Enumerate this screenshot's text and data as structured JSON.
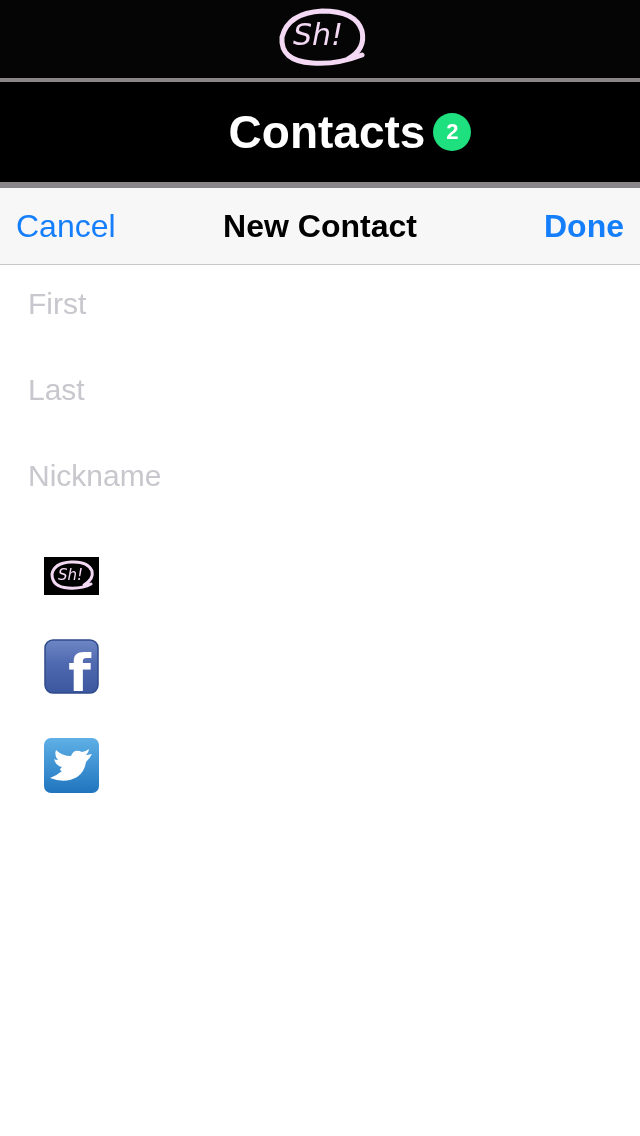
{
  "logo": {
    "text": "Sh!"
  },
  "title_bar": {
    "title": "Contacts",
    "badge": "2"
  },
  "nav_bar": {
    "cancel": "Cancel",
    "title": "New Contact",
    "done": "Done"
  },
  "fields": [
    {
      "placeholder": "First"
    },
    {
      "placeholder": "Last"
    },
    {
      "placeholder": "Nickname"
    }
  ],
  "services": [
    {
      "kind": "sh",
      "text": "Sh!"
    },
    {
      "kind": "facebook",
      "text": "f"
    },
    {
      "kind": "twitter"
    }
  ]
}
